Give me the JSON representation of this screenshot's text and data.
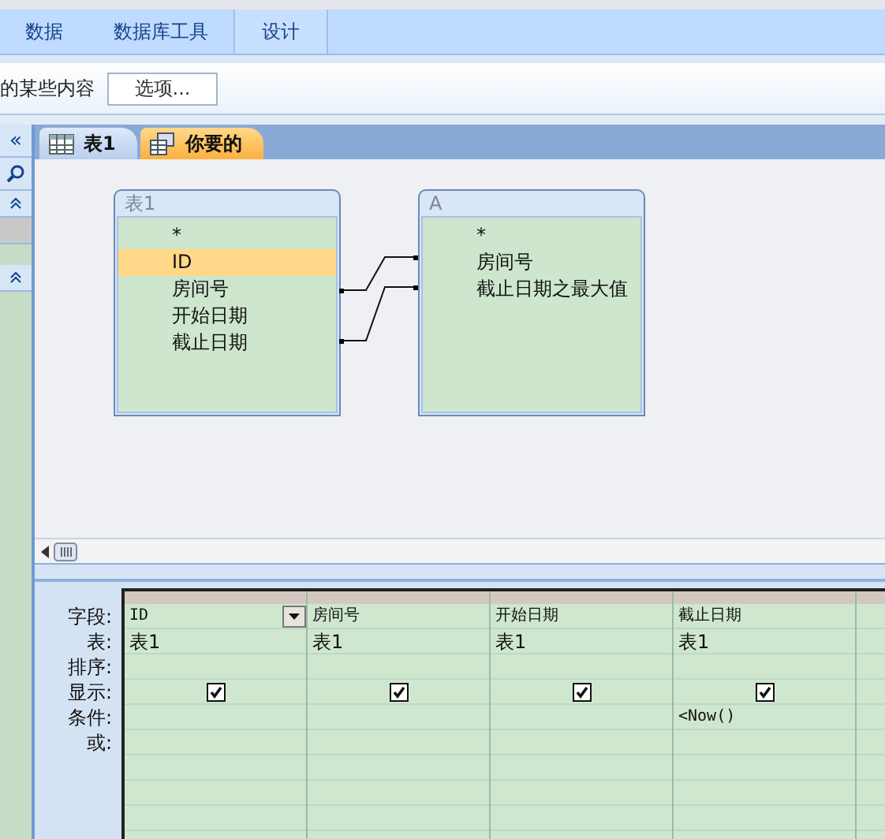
{
  "ribbon_tabs": [
    {
      "label": "数据",
      "selected": false
    },
    {
      "label": "数据库工具",
      "selected": false
    },
    {
      "label": "设计",
      "selected": true
    }
  ],
  "message_bar": {
    "text": "的某些内容",
    "button": "选项..."
  },
  "nav_pane": {
    "collapse": "«"
  },
  "doc_tabs": [
    {
      "label": "表1",
      "kind": "table",
      "selected": false
    },
    {
      "label": "你要的",
      "kind": "query",
      "selected": true
    }
  ],
  "tables": [
    {
      "title": "表1",
      "fields": [
        {
          "name": "*",
          "selected": false
        },
        {
          "name": "ID",
          "selected": true
        },
        {
          "name": "房间号",
          "selected": false
        },
        {
          "name": "开始日期",
          "selected": false
        },
        {
          "name": "截止日期",
          "selected": false
        }
      ]
    },
    {
      "title": "A",
      "fields": [
        {
          "name": "*",
          "selected": false
        },
        {
          "name": "房间号",
          "selected": false
        },
        {
          "name": "截止日期之最大值",
          "selected": false
        }
      ]
    }
  ],
  "grid": {
    "row_labels": [
      "字段:",
      "表:",
      "排序:",
      "显示:",
      "条件:",
      "或:"
    ],
    "columns": [
      {
        "field": "ID",
        "table": "表1",
        "show": true,
        "dropdown": true
      },
      {
        "field": "房间号",
        "table": "表1",
        "show": true,
        "dropdown": false
      },
      {
        "field": "开始日期",
        "table": "表1",
        "show": true,
        "dropdown": false
      },
      {
        "field": "截止日期",
        "table": "表1",
        "show": true,
        "criteria": "<Now()",
        "dropdown": false
      }
    ]
  }
}
